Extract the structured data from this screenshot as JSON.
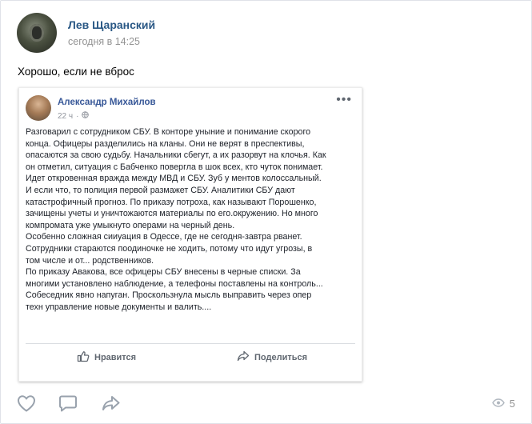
{
  "post": {
    "author": "Лев Щаранский",
    "time": "сегодня в 14:25",
    "text": "Хорошо, если не вброс",
    "views": "5"
  },
  "repost": {
    "author": "Александр Михайлов",
    "time": "22 ч",
    "more": "•••",
    "lines": [
      "Разговарил с сотрудником СБУ. В конторе уныние и понимание скорого",
      "конца. Офицеры разделились на кланы. Они не верят в преспективы,",
      "опасаются за свою судьбу. Начальники сбегут, а их разорвут на клочья. Как",
      "он отметил, ситуация с Бабченко повергла в шок всех, кто чуток понимает.",
      "Идет откровенная вражда между МВД и СБУ. Зуб у ментов колоссальный.",
      "И если что, то полиция первой размажет СБУ. Аналитики СБУ дают",
      "катастрофичный прогноз. По приказу потроха, как называют Порошенко,",
      "зачищены учеты и уничтожаются материалы по его.окружению. Но много",
      "компромата уже умыкнуто операми на черный день.",
      "Особенно сложная сииуация в Одессе, где не сегодня-завтра рванет.",
      "Сотрудники стараются поодиночке не ходить, потому что идут угрозы, в",
      "том числе и от... родственников.",
      "По приказу Авакова, все офицеры СБУ внесены в черные списки. За",
      "многими установлено наблюдение, а телефоны поставлены на контроль...",
      "Собеседник явно напуган. Проскользнула мысль выправить через опер",
      "техн управление новые документы и валить...."
    ],
    "like_label": "Нравится",
    "share_label": "Поделиться"
  },
  "icons": {
    "like": "heart-icon",
    "comment": "comment-icon",
    "share": "share-icon",
    "views": "eye-icon"
  }
}
